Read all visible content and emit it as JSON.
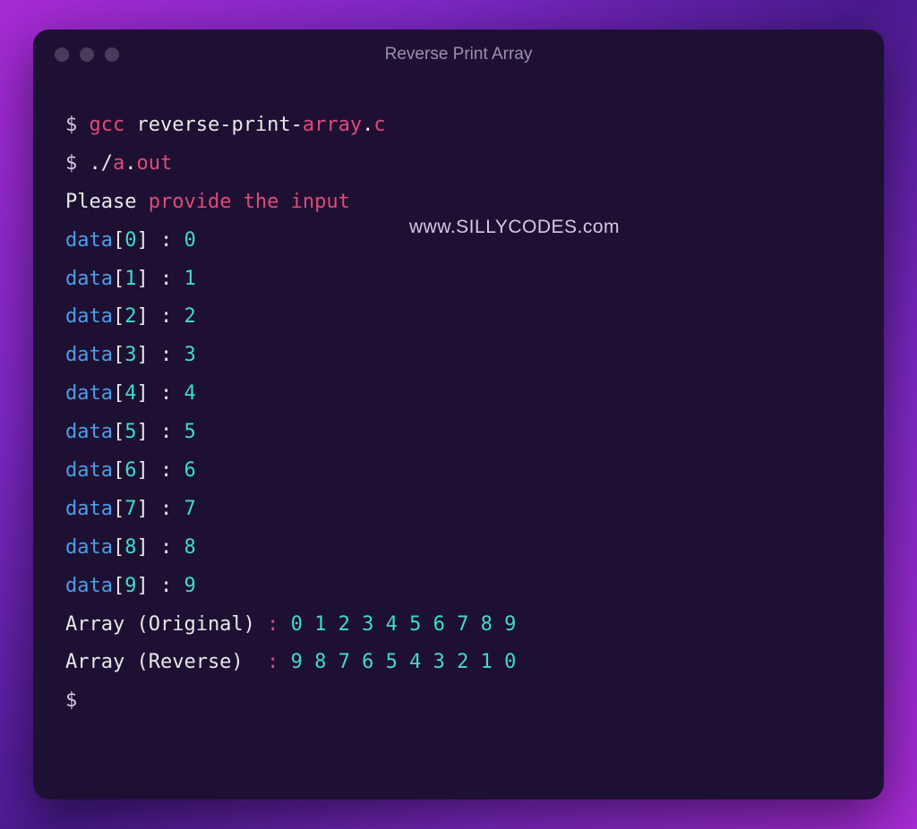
{
  "window": {
    "title": "Reverse Print Array"
  },
  "watermark": "www.SILLYCODES.com",
  "lines": {
    "prompt1": "$ ",
    "gcc": "gcc ",
    "filename1": "reverse-print-",
    "filename2": "array",
    "filename3": ".",
    "filename4": "c",
    "prompt2": "$ ",
    "dotslash": "./",
    "a": "a",
    "dot": ".",
    "out": "out",
    "please": "Please ",
    "provide": "provide the input",
    "prompt3": "$"
  },
  "data_entries": [
    {
      "index": "0",
      "value": "0"
    },
    {
      "index": "1",
      "value": "1"
    },
    {
      "index": "2",
      "value": "2"
    },
    {
      "index": "3",
      "value": "3"
    },
    {
      "index": "4",
      "value": "4"
    },
    {
      "index": "5",
      "value": "5"
    },
    {
      "index": "6",
      "value": "6"
    },
    {
      "index": "7",
      "value": "7"
    },
    {
      "index": "8",
      "value": "8"
    },
    {
      "index": "9",
      "value": "9"
    }
  ],
  "arrays": {
    "original_label": "Array (Original) ",
    "original_colon": ": ",
    "original_values": "0 1 2 3 4 5 6 7 8 9",
    "reverse_label": "Array (Reverse)  ",
    "reverse_colon": ": ",
    "reverse_values": "9 8 7 6 5 4 3 2 1 0"
  },
  "data_template": {
    "word": "data",
    "open": "[",
    "close": "] ",
    "sep": ": "
  }
}
